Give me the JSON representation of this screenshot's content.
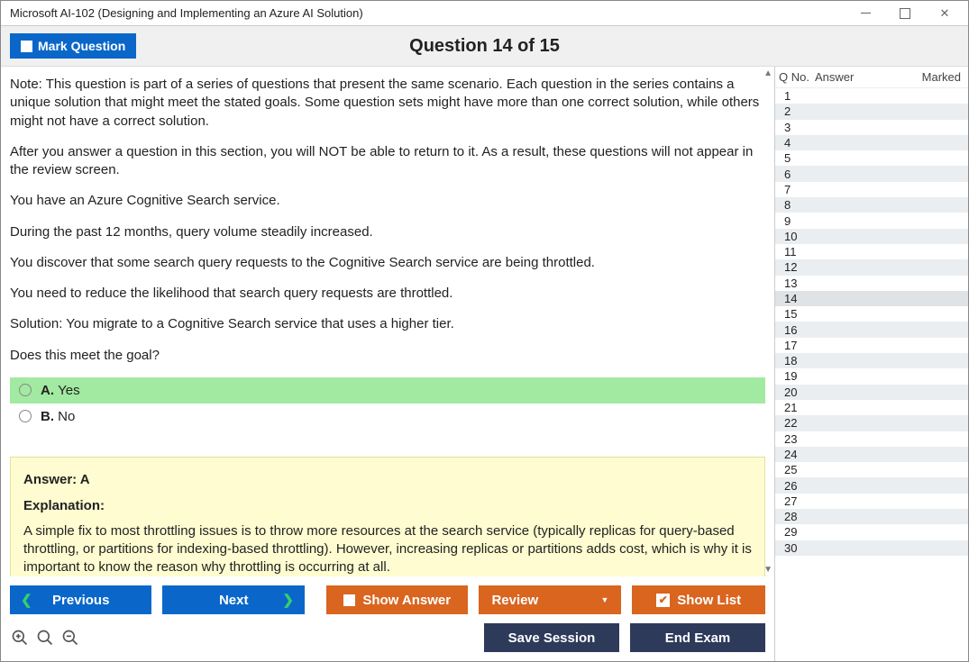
{
  "window": {
    "title": "Microsoft AI-102 (Designing and Implementing an Azure AI Solution)"
  },
  "header": {
    "mark_label": "Mark Question",
    "question_title": "Question 14 of 15"
  },
  "question": {
    "paragraphs": [
      "Note: This question is part of a series of questions that present the same scenario. Each question in the series contains a unique solution that might meet the stated goals. Some question sets might have more than one correct solution, while others might not have a correct solution.",
      "After you answer a question in this section, you will NOT be able to return to it. As a result, these questions will not appear in the review screen.",
      "You have an Azure Cognitive Search service.",
      "During the past 12 months, query volume steadily increased.",
      "You discover that some search query requests to the Cognitive Search service are being throttled.",
      "You need to reduce the likelihood that search query requests are throttled.",
      "Solution: You migrate to a Cognitive Search service that uses a higher tier.",
      "Does this meet the goal?"
    ],
    "choices": [
      {
        "letter": "A.",
        "text": "Yes",
        "correct": true
      },
      {
        "letter": "B.",
        "text": "No",
        "correct": false
      }
    ]
  },
  "explanation": {
    "answer_label": "Answer: A",
    "explanation_label": "Explanation:",
    "text": "A simple fix to most throttling issues is to throw more resources at the search service (typically replicas for query-based throttling, or partitions for indexing-based throttling). However, increasing replicas or partitions adds cost, which is why it is important to know the reason why throttling is occurring at all."
  },
  "sidebar": {
    "col_qno": "Q No.",
    "col_answer": "Answer",
    "col_marked": "Marked",
    "rows": [
      {
        "n": "1"
      },
      {
        "n": "2"
      },
      {
        "n": "3"
      },
      {
        "n": "4"
      },
      {
        "n": "5"
      },
      {
        "n": "6"
      },
      {
        "n": "7"
      },
      {
        "n": "8"
      },
      {
        "n": "9"
      },
      {
        "n": "10"
      },
      {
        "n": "11"
      },
      {
        "n": "12"
      },
      {
        "n": "13"
      },
      {
        "n": "14"
      },
      {
        "n": "15"
      },
      {
        "n": "16"
      },
      {
        "n": "17"
      },
      {
        "n": "18"
      },
      {
        "n": "19"
      },
      {
        "n": "20"
      },
      {
        "n": "21"
      },
      {
        "n": "22"
      },
      {
        "n": "23"
      },
      {
        "n": "24"
      },
      {
        "n": "25"
      },
      {
        "n": "26"
      },
      {
        "n": "27"
      },
      {
        "n": "28"
      },
      {
        "n": "29"
      },
      {
        "n": "30"
      }
    ],
    "current": 14
  },
  "footer": {
    "previous": "Previous",
    "next": "Next",
    "show_answer": "Show Answer",
    "review": "Review",
    "show_list": "Show List",
    "save_session": "Save Session",
    "end_exam": "End Exam"
  }
}
